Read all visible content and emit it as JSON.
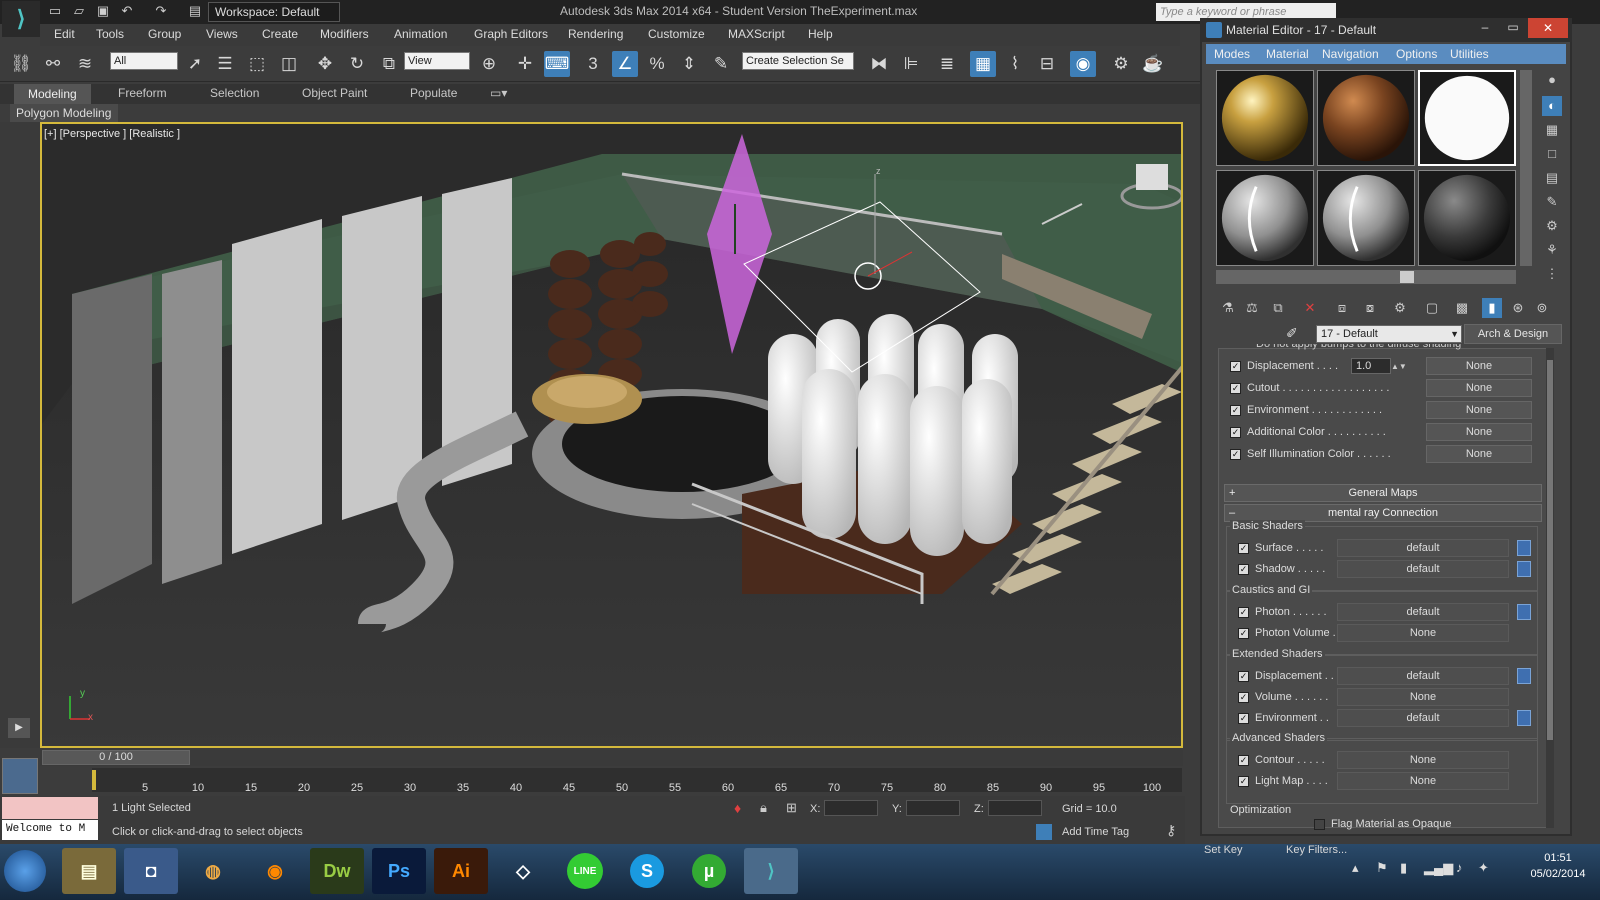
{
  "app": {
    "title": "Autodesk 3ds Max  2014 x64   - Student Version    TheExperiment.max",
    "workspace": "Workspace: Default",
    "search_placeholder": "Type a keyword or phrase"
  },
  "menu": [
    "Edit",
    "Tools",
    "Group",
    "Views",
    "Create",
    "Modifiers",
    "Animation",
    "Graph Editors",
    "Rendering",
    "Customize",
    "MAXScript",
    "Help"
  ],
  "toolbar": {
    "selection_filter": "All",
    "ref_coord": "View",
    "selection_set_placeholder": "Create Selection Se"
  },
  "ribbon": {
    "tabs": [
      "Modeling",
      "Freeform",
      "Selection",
      "Object Paint",
      "Populate"
    ],
    "subpanel": "Polygon Modeling"
  },
  "viewport": {
    "label": "[+] [Perspective ] [Realistic ]",
    "axis_y": "y",
    "axis_x": "x",
    "axis_z": "z"
  },
  "timeline": {
    "slider": "0 / 100",
    "ticks": [
      "5",
      "10",
      "15",
      "20",
      "25",
      "30",
      "35",
      "40",
      "45",
      "50",
      "55",
      "60",
      "65",
      "70",
      "75",
      "80",
      "85",
      "90",
      "95",
      "100"
    ]
  },
  "status": {
    "maxscript": "Welcome to M",
    "selected": "1 Light Selected",
    "prompt": "Click or click-and-drag to select objects",
    "x_label": "X:",
    "y_label": "Y:",
    "z_label": "Z:",
    "grid": "Grid = 10.0",
    "add_time_tag": "Add Time Tag",
    "set_key": "Set Key",
    "key_filters": "Key Filters...",
    "frame": "0"
  },
  "material_editor": {
    "title": "Material Editor - 17 - Default",
    "menu": [
      "Modes",
      "Material",
      "Navigation",
      "Options",
      "Utilities"
    ],
    "material_name": "17 - Default",
    "material_type": "Arch & Design",
    "cut_text": "Do not apply bumps to the diffuse shading",
    "maps": [
      {
        "label": "Displacement . . . .",
        "value": "1.0",
        "button": "None"
      },
      {
        "label": "Cutout . . . . . . . . . . . . . . . . . .",
        "button": "None"
      },
      {
        "label": "Environment . . . . . . . . . . . .",
        "button": "None"
      },
      {
        "label": "Additional Color . . . . . . . . . .",
        "button": "None"
      },
      {
        "label": "Self Illumination Color . . . . . .",
        "button": "None"
      }
    ],
    "general_maps": "General Maps",
    "mental_ray": "mental ray Connection",
    "basic_shaders": {
      "title": "Basic Shaders",
      "rows": [
        {
          "label": "Surface . . . . .",
          "button": "default"
        },
        {
          "label": "Shadow . . . . .",
          "button": "default"
        }
      ]
    },
    "caustics": {
      "title": "Caustics and GI",
      "rows": [
        {
          "label": "Photon . . . . . .",
          "button": "default"
        },
        {
          "label": "Photon Volume .",
          "button": "None"
        }
      ]
    },
    "extended": {
      "title": "Extended Shaders",
      "rows": [
        {
          "label": "Displacement . .",
          "button": "default"
        },
        {
          "label": "Volume . . . . . .",
          "button": "None"
        },
        {
          "label": "Environment . .",
          "button": "default"
        }
      ]
    },
    "advanced": {
      "title": "Advanced Shaders",
      "rows": [
        {
          "label": "Contour . . . . .",
          "button": "None"
        },
        {
          "label": "Light Map . . . .",
          "button": "None"
        }
      ]
    },
    "optimization": {
      "title": "Optimization",
      "flag": "Flag Material as Opaque"
    }
  },
  "taskbar": {
    "apps": [
      "Dw",
      "Ps",
      "Ai"
    ],
    "time": "01:51",
    "date": "05/02/2014"
  },
  "colors": {
    "accent": "#d4b93c",
    "me_menu": "#5a8cc0",
    "light_plane": "#cc66dd"
  }
}
